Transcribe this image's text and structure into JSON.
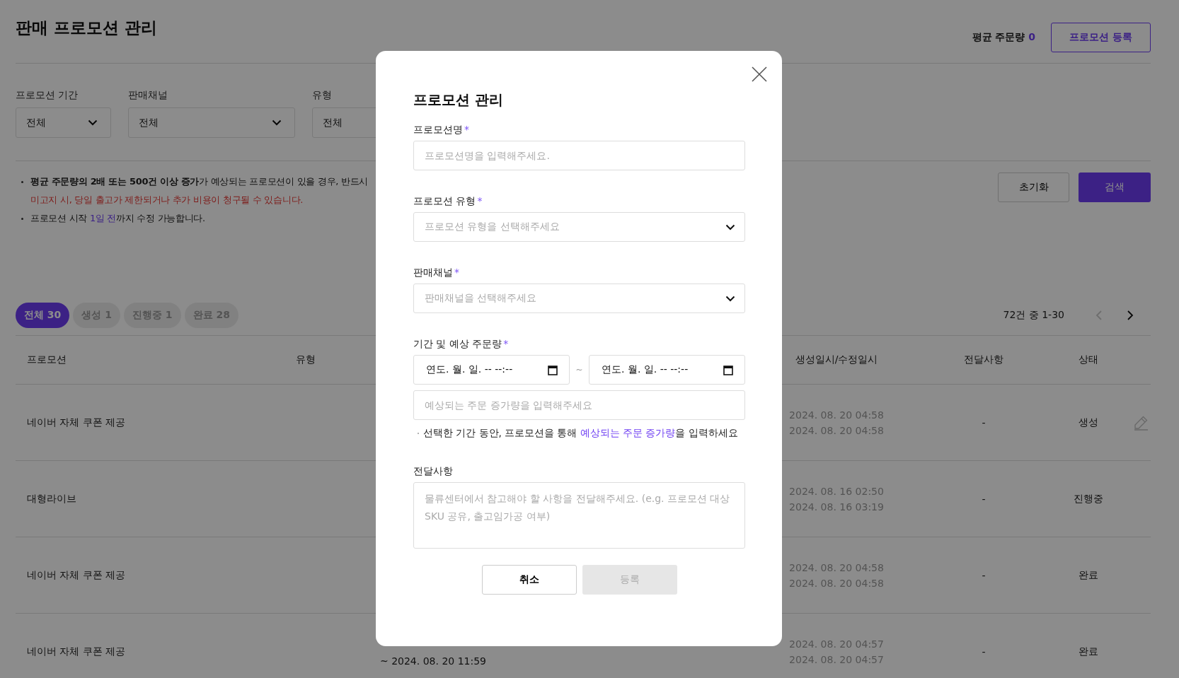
{
  "page": {
    "title": "판매 프로모션 관리",
    "avg_orders_label": "평균 주문량",
    "avg_orders_value": "0",
    "register_button": "프로모션 등록"
  },
  "filters": [
    {
      "label": "프로모션 기간",
      "value": "전체"
    },
    {
      "label": "판매채널",
      "value": "전체"
    },
    {
      "label": "유형",
      "value": "전체"
    }
  ],
  "notices": [
    {
      "text": "**평균 주문량의 2배 또는 500건 이상 증가**가 예상되는 프로모션이 있을 경우, 반드시",
      "warning": "미고지 시, 당일 출고가 제한되거나 추가 비용이 청구될 수 있습니다."
    },
    {
      "before": "프로모션 시작 ",
      "highlight": "1일 전",
      "after": "까지 수정 가능합니다."
    }
  ],
  "reset_button": "초기화",
  "search_button": "검색",
  "status_tabs": [
    {
      "label": "전체 30",
      "selected": true
    },
    {
      "label": "생성 1",
      "selected": false
    },
    {
      "label": "진행중 1",
      "selected": false
    },
    {
      "label": "완료 28",
      "selected": false
    }
  ],
  "pagination": {
    "range": "72건 중 1-30",
    "prev_disabled": true,
    "next_disabled": false
  },
  "table": {
    "columns": [
      "프로모션",
      "유형",
      "생성일시/수정일시",
      "전달사항",
      "상태"
    ],
    "rows": [
      {
        "promotion": "네이버 자체 쿠폰 제공",
        "created": "2024. 08. 20 04:58",
        "modified": "2024. 08. 20 04:58",
        "note": "-",
        "status": "생성",
        "editable": true
      },
      {
        "promotion": "대형라이브",
        "created": "2024. 08. 16 02:50",
        "modified": "2024. 08. 16 03:19",
        "note": "-",
        "status": "진행중",
        "editable": false
      },
      {
        "promotion": "네이버 자체 쿠폰 제공",
        "created": "2024. 08. 20 04:58",
        "modified": "2024. 08. 20 04:58",
        "note": "-",
        "status": "완료",
        "editable": false
      },
      {
        "promotion": "네이버 자체 쿠폰 제공",
        "period_end": "~ 2024. 08. 20 11:59",
        "created": "2024. 08. 20 04:57",
        "modified": "2024. 08. 20 04:57",
        "note": "-",
        "status": "완료",
        "editable": false
      }
    ]
  },
  "modal": {
    "title": "프로모션 관리",
    "fields": [
      {
        "kind": "input",
        "label": "프로모션명",
        "required_mark": "*",
        "placeholder": "프로모션명을 입력해주세요."
      },
      {
        "kind": "select",
        "label": "프로모션 유형",
        "required_mark": "*",
        "placeholder": "프로모션 유형을 선택해주세요"
      },
      {
        "kind": "select",
        "label": "판매채널",
        "required_mark": "*",
        "placeholder": "판매채널을 선택해주세요"
      },
      {
        "kind": "period",
        "label": "기간 및 예상 주문량",
        "required_mark": "*",
        "start": "연도. 월. 일. -- --:--",
        "separator": "~",
        "end": "연도. 월. 일. -- --:--",
        "placeholder": "예상되는 주문 증가량을 입력해주세요",
        "hint": {
          "before": "선택한 기간 동안, 프로모션을 통해 ",
          "highlight": "예상되는 주문 증가량",
          "after": "을 입력하세요"
        }
      },
      {
        "kind": "textarea",
        "label": "전달사항",
        "placeholder": "물류센터에서 참고해야 할 사항을 전달해주세요. (e.g. 프로모션 대상 SKU 공유, 출고임가공 여부)"
      }
    ],
    "cancel_button": "취소",
    "submit_button": "등록",
    "submit_disabled": true
  }
}
